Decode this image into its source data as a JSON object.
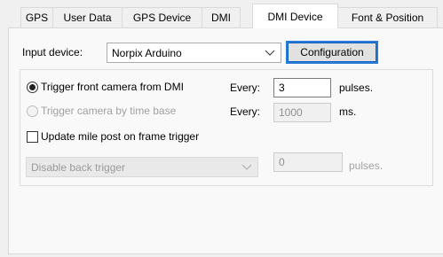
{
  "tabs": [
    {
      "label": "GPS",
      "active": false
    },
    {
      "label": "User Data",
      "active": false
    },
    {
      "label": "GPS Device",
      "active": false
    },
    {
      "label": "DMI",
      "active": false
    },
    {
      "label": "DMI Device",
      "active": true
    },
    {
      "label": "Font & Position",
      "active": false
    }
  ],
  "input_device": {
    "label": "Input device:",
    "value": "Norpix Arduino",
    "config_button": "Configuration"
  },
  "trigger_group": {
    "front_camera": {
      "label": "Trigger front camera from DMI",
      "checked": true,
      "every_label": "Every:",
      "value": "3",
      "unit": "pulses."
    },
    "time_base": {
      "label": "Trigger camera by time base",
      "checked": false,
      "every_label": "Every:",
      "value": "1000",
      "unit": "ms."
    },
    "update_milepost": {
      "label": "Update mile post on frame trigger",
      "checked": false
    },
    "back_trigger": {
      "value": "Disable back trigger",
      "pulses_value": "0",
      "unit": "pulses."
    }
  },
  "colors": {
    "accent": "#0078d7",
    "disabled_text": "#a0a0a0"
  }
}
